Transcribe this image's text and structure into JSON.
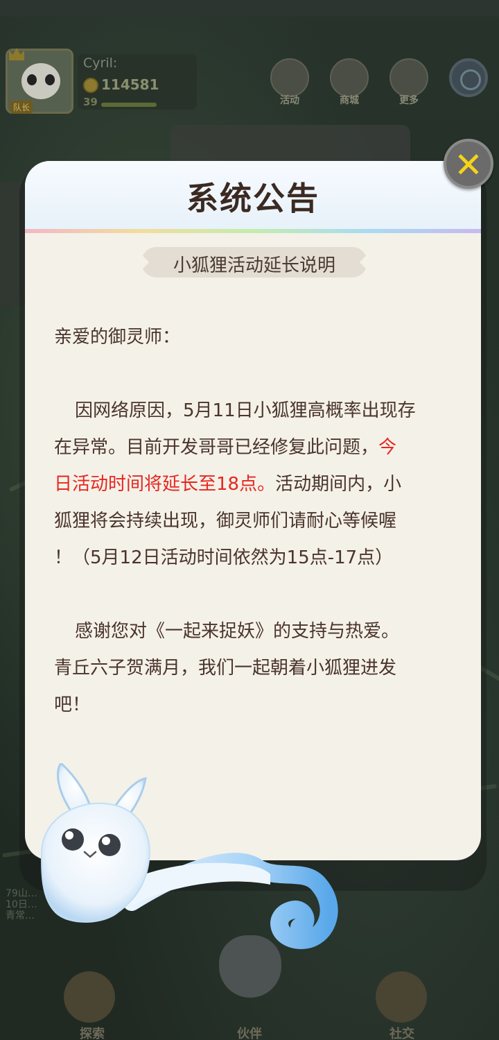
{
  "player": {
    "name": "Cyril:",
    "coins": "114581",
    "level": "39",
    "badge": "队长"
  },
  "top_menu": [
    {
      "label": "活动",
      "icon": "gift-icon"
    },
    {
      "label": "商城",
      "icon": "shop-icon"
    },
    {
      "label": "更多",
      "icon": "more-grid-icon"
    }
  ],
  "bottom_nav": [
    {
      "label": "探索",
      "icon": "map-pin-icon"
    },
    {
      "label": "伙伴",
      "icon": "mascot-icon"
    },
    {
      "label": "社交",
      "icon": "people-icon"
    }
  ],
  "bg_log": [
    "79山…",
    "10日…",
    "青常…"
  ],
  "dialog": {
    "title": "系统公告",
    "subtitle": "小狐狸活动延长说明",
    "greeting": "亲爱的御灵师：",
    "para1_line1": "因网络原因，5月11日小狐狸高概率出现存",
    "para1_line2a": "在异常。目前开发哥哥已经修复此问题，",
    "para1_line2b": "今",
    "para1_line3a": "日活动时间将延长至18点。",
    "para1_line3b": "活动期间内，小",
    "para1_line4": "狐狸将会持续出现，御灵师们请耐心等候喔",
    "para1_line5": "！（5月12日活动时间依然为15点-17点）",
    "para2_line1": "感谢您对《一起来捉妖》的支持与热爱。",
    "para2_line2": "青丘六子贺满月，我们一起朝着小狐狸进发",
    "para2_line3": "吧！",
    "close_icon": "✕"
  },
  "colors": {
    "highlight": "#e5271f",
    "text": "#4a342b",
    "close_x": "#f6d21a"
  }
}
